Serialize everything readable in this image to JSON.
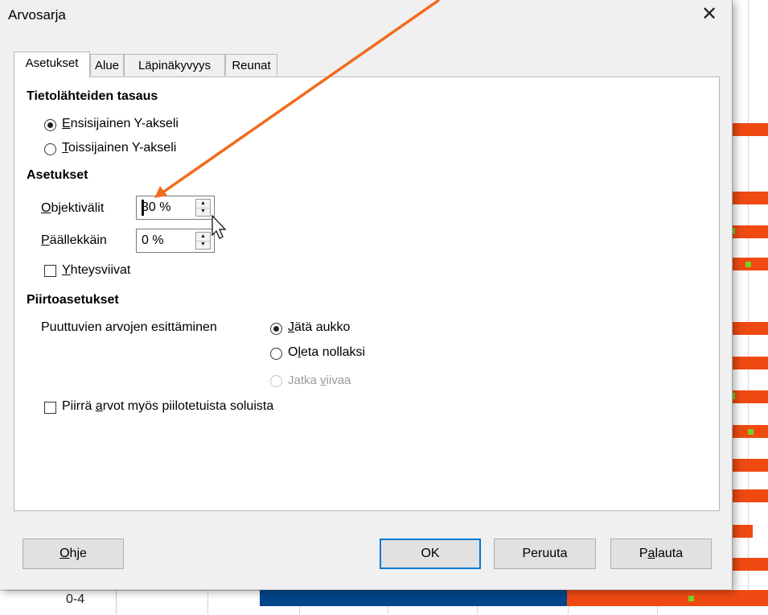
{
  "dialog": {
    "title": "Arvosarja",
    "close_icon": "close-icon"
  },
  "tabs": [
    {
      "label": "Asetukset",
      "active": true
    },
    {
      "label": "Alue",
      "active": false
    },
    {
      "label": "Läpinäkyvyys",
      "active": false
    },
    {
      "label": "Reunat",
      "active": false
    }
  ],
  "alignment": {
    "heading": "Tietolähteiden tasaus",
    "primary": {
      "mnemonic": "E",
      "rest": "nsisijainen Y-akseli",
      "checked": true
    },
    "secondary": {
      "mnemonic": "T",
      "rest": "oissijainen Y-akseli",
      "checked": false
    }
  },
  "settings": {
    "heading": "Asetukset",
    "spacing": {
      "mnemonic": "O",
      "rest": "bjektivälit",
      "value": "30 %"
    },
    "overlap": {
      "mnemonic": "P",
      "rest": "äällekkäin",
      "value": "0 %"
    },
    "connection_lines": {
      "mnemonic": "Y",
      "rest": "hteysviivat",
      "checked": false
    }
  },
  "plot_options": {
    "heading": "Piirtoasetukset",
    "missing_label": "Puuttuvien arvojen esittäminen",
    "leave_gap": {
      "mnemonic": "J",
      "rest": "ätä aukko",
      "checked": true
    },
    "assume_zero": {
      "pre": "O",
      "mnemonic": "l",
      "rest": "eta nollaksi",
      "checked": false
    },
    "continue_line": {
      "pre": "Jatka ",
      "mnemonic": "v",
      "rest": "iivaa",
      "checked": false,
      "disabled": true
    },
    "hidden_cells": {
      "pre": "Piirrä ",
      "mnemonic": "a",
      "rest": "rvot myös piilotetuista soluista",
      "checked": false
    }
  },
  "buttons": {
    "help": {
      "mnemonic": "O",
      "rest": "hje"
    },
    "ok": "OK",
    "cancel": "Peruuta",
    "reset": {
      "pre": "P",
      "mnemonic": "a",
      "rest": "lauta"
    }
  },
  "background": {
    "row_label": "0-4",
    "bar_color": "#f04a12",
    "blue_color": "#00468b",
    "marker_color": "#7ad321"
  },
  "annotation": {
    "arrow_color": "#f26b1d"
  }
}
